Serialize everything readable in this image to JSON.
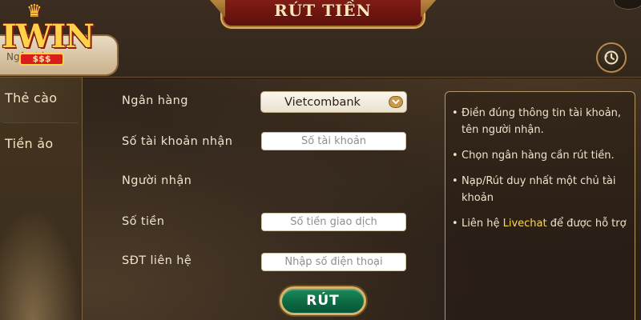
{
  "header": {
    "title": "RÚT TIỀN"
  },
  "logo": {
    "brand": "IWIN",
    "badge": "$$$",
    "subtext": "Ngân hàng"
  },
  "sidebar": {
    "items": [
      {
        "label": "Thẻ cào"
      },
      {
        "label": "Tiền ảo"
      }
    ]
  },
  "form": {
    "bank": {
      "label": "Ngân hàng",
      "value": "Vietcombank"
    },
    "account_number": {
      "label": "Số tài khoản nhận",
      "placeholder": "Số tài khoản"
    },
    "recipient": {
      "label": "Người nhận"
    },
    "amount": {
      "label": "Số tiền",
      "placeholder": "Số tiền giao dịch"
    },
    "phone": {
      "label": "SĐT liên hệ",
      "placeholder": "Nhập số điện thoại"
    },
    "submit_label": "RÚT"
  },
  "info": {
    "item1": "Điền đúng thông tin tài khoản, tên người nhận.",
    "item2": "Chọn ngân hàng cần rút tiền.",
    "item3": "Nạp/Rút duy nhất một chủ tài khoản",
    "item4_prefix": "Liên hệ ",
    "item4_highlight": "Livechat",
    "item4_suffix": " để được hỗ trợ"
  },
  "colors": {
    "accent_gold": "#d7b46b",
    "highlight": "#ffd94a",
    "title_red": "#8a1f1a",
    "submit_green": "#0c6a42"
  },
  "icons": {
    "history": "history-clock-icon",
    "dropdown": "chevron-down-icon",
    "crown": "crown-icon"
  }
}
